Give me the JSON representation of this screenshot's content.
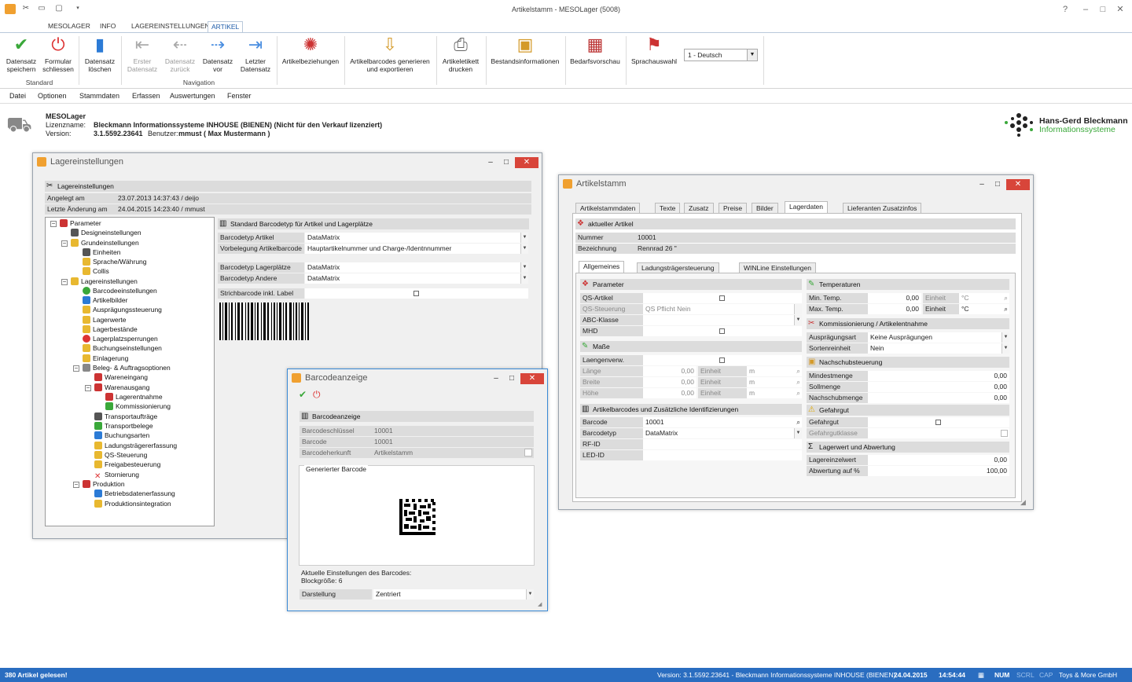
{
  "window": {
    "title": "Artikelstamm - MESOLager (5008)"
  },
  "ribbon_tabs": [
    "MESOLAGER",
    "INFO",
    "LAGEREINSTELLUNGEN",
    "ARTIKEL"
  ],
  "ribbon": {
    "buttons": [
      {
        "label": "Datensatz\nspeichern",
        "icon": "checkmark-icon"
      },
      {
        "label": "Formular\nschliessen",
        "icon": "power-icon"
      },
      {
        "label": "Datensatz\nlöschen",
        "icon": "trash-icon"
      },
      {
        "label": "Erster\nDatensatz",
        "icon": "first-icon"
      },
      {
        "label": "Datensatz\nzurück",
        "icon": "back-icon"
      },
      {
        "label": "Datensatz\nvor",
        "icon": "forward-icon"
      },
      {
        "label": "Letzter\nDatensatz",
        "icon": "last-icon"
      },
      {
        "label": "Artikelbeziehungen",
        "icon": "relation-icon"
      },
      {
        "label": "Artikelbarcodes generieren\nund exportieren",
        "icon": "export-icon"
      },
      {
        "label": "Artikeletikett\ndrucken",
        "icon": "printer-icon"
      },
      {
        "label": "Bestandsinformationen",
        "icon": "box-icon"
      },
      {
        "label": "Bedarfsvorschau",
        "icon": "calendar-icon"
      },
      {
        "label": "Sprachauswahl",
        "icon": "flags-icon"
      }
    ],
    "groups": [
      "Standard",
      "Navigation"
    ],
    "language": "1 - Deutsch"
  },
  "menu": [
    "Datei",
    "Optionen",
    "Stammdaten",
    "Erfassen",
    "Auswertungen",
    "Fenster"
  ],
  "info": {
    "product": "MESOLager",
    "lizenz_label": "Lizenzname:",
    "lizenz": "Bleckmann Informationssysteme INHOUSE (BIENEN) (Nicht für den Verkauf lizenziert)",
    "version_label": "Version:",
    "version": "3.1.5592.23641",
    "benutzer_label": "Benutzer:",
    "benutzer": "mmust ( Max Mustermann )",
    "logo_line1": "Hans-Gerd Bleckmann",
    "logo_line2": "Informationssysteme"
  },
  "lager": {
    "title": "Lagereinstellungen",
    "section": "Lagereinstellungen",
    "angelegt_label": "Angelegt am",
    "angelegt": "23.07.2013 14:37:43 / deijo",
    "aenderung_label": "Letzte Änderung am",
    "aenderung": "24.04.2015 14:23:40 / mmust",
    "tree": [
      "Parameter",
      "Designeinstellungen",
      "Grundeinstellungen",
      "Einheiten",
      "Sprache/Währung",
      "Collis",
      "Lagereinstellungen",
      "Barcodeeinstellungen",
      "Artikelbilder",
      "Ausprägungssteuerung",
      "Lagerwerte",
      "Lagerbestände",
      "Lagerplatzsperrungen",
      "Buchungseinstellungen",
      "Einlagerung",
      "Beleg- & Auftragsoptionen",
      "Wareneingang",
      "Warenausgang",
      "Lagerentnahme",
      "Kommissionierung",
      "Transportaufträge",
      "Transportbelege",
      "Buchungsarten",
      "Ladungsträgererfassung",
      "QS-Steuerung",
      "Freigabesteuerung",
      "Stornierung",
      "Produktion",
      "Betriebsdatenerfassung",
      "Produktionsintegration"
    ],
    "barcode_section": "Standard Barcodetyp für Artikel und Lagerplätze",
    "rows": [
      {
        "label": "Barcodetyp Artikel",
        "value": "DataMatrix"
      },
      {
        "label": "Vorbelegung Artikelbarcode",
        "value": "Hauptartikelnummer und Charge-/Identnnummer"
      },
      {
        "label": "Barcodetyp Lagerplätze",
        "value": "DataMatrix"
      },
      {
        "label": "Barcodetyp Andere",
        "value": "DataMatrix"
      },
      {
        "label": "Strichbarcode inkl. Label",
        "value": ""
      }
    ]
  },
  "barcode": {
    "title": "Barcodeanzeige",
    "section": "Barcodeanzeige",
    "rows": [
      {
        "label": "Barcodeschlüssel",
        "value": "10001"
      },
      {
        "label": "Barcode",
        "value": "10001"
      },
      {
        "label": "Barcodeherkunft",
        "value": "Artikelstamm"
      }
    ],
    "generated": "Generierter Barcode",
    "settings_line1": "Aktuelle Einstellungen des Barcodes:",
    "settings_line2": "Blockgröße: 6",
    "darstellung_label": "Darstellung",
    "darstellung": "Zentriert"
  },
  "artikel": {
    "title": "Artikelstamm",
    "tabs": [
      "Artikelstammdaten",
      "Texte",
      "Zusatz",
      "Preise",
      "Bilder",
      "Lagerdaten",
      "Lieferanten Zusatzinfos"
    ],
    "current": "aktueller Artikel",
    "nummer_label": "Nummer",
    "nummer": "10001",
    "bez_label": "Bezeichnung",
    "bez": "Rennrad 26 \"",
    "subtabs": [
      "Allgemeines",
      "Ladungsträgersteuerung",
      "WINLine Einstellungen"
    ],
    "param": {
      "title": "Parameter",
      "qs_artikel": "QS-Artikel",
      "qs_steuerung": "QS-Steuerung",
      "qs_steuerung_val": "QS Pflicht Nein",
      "abc": "ABC-Klasse",
      "mhd": "MHD"
    },
    "masse": {
      "title": "Maße",
      "laengenverw": "Laengenverw.",
      "rows": [
        {
          "label": "Länge",
          "value": "0,00",
          "unit_label": "Einheit",
          "unit": "m"
        },
        {
          "label": "Breite",
          "value": "0,00",
          "unit_label": "Einheit",
          "unit": "m"
        },
        {
          "label": "Höhe",
          "value": "0,00",
          "unit_label": "Einheit",
          "unit": "m"
        }
      ]
    },
    "barcodes": {
      "title": "Artikelbarcodes und Zusätzliche Identifizierungen",
      "barcode_label": "Barcode",
      "barcode": "10001",
      "typ_label": "Barcodetyp",
      "typ": "DataMatrix",
      "rfid": "RF-ID",
      "ledid": "LED-ID"
    },
    "temp": {
      "title": "Temperaturen",
      "rows": [
        {
          "label": "Min. Temp.",
          "value": "0,00",
          "unit_label": "Einheit",
          "unit": "°C"
        },
        {
          "label": "Max. Temp.",
          "value": "0,00",
          "unit_label": "Einheit",
          "unit": "°C"
        }
      ]
    },
    "komm": {
      "title": "Kommissionierung / Artikelentnahme",
      "rows": [
        {
          "label": "Ausprägungsart",
          "value": "Keine Ausprägungen"
        },
        {
          "label": "Sortenreinheit",
          "value": "Nein"
        }
      ]
    },
    "nachschub": {
      "title": "Nachschubsteuerung",
      "rows": [
        {
          "label": "Mindestmenge",
          "value": "0,00"
        },
        {
          "label": "Sollmenge",
          "value": "0,00"
        },
        {
          "label": "Nachschubmenge",
          "value": "0,00"
        }
      ]
    },
    "gefahr": {
      "title": "Gefahrgut",
      "gefahrgut": "Gefahrgut",
      "klasse": "Gefahrgutklasse"
    },
    "lagerwert": {
      "title": "Lagerwert und Abwertung",
      "rows": [
        {
          "label": "Lagereinzelwert",
          "value": "0,00"
        },
        {
          "label": "Abwertung auf %",
          "value": "100,00"
        }
      ]
    }
  },
  "status": {
    "left": "380 Artikel gelesen!",
    "version": "Version: 3.1.5592.23641 - Bleckmann Informationssysteme INHOUSE (BIENEN)",
    "date": "24.04.2015",
    "time": "14:54:44",
    "num": "NUM",
    "scrl": "SCRL",
    "cap": "CAP",
    "company": "Toys & More GmbH"
  },
  "colors": {
    "accent": "#2a6dc0",
    "close": "#d8453a"
  }
}
